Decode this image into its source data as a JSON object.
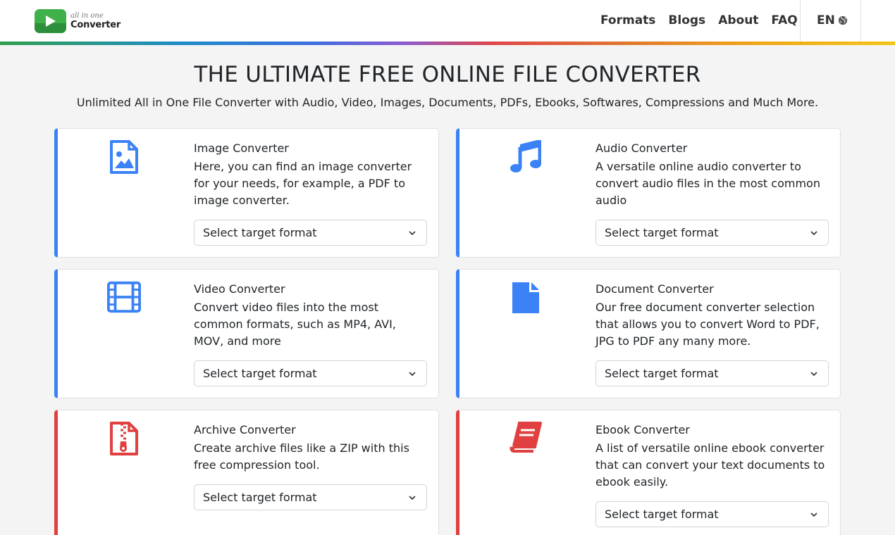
{
  "brand": {
    "tagline": "all in one",
    "name": "Converter"
  },
  "nav": {
    "items": [
      "Formats",
      "Blogs",
      "About",
      "FAQ"
    ],
    "language": "EN"
  },
  "hero": {
    "title": "THE ULTIMATE FREE ONLINE FILE CONVERTER",
    "subtitle": "Unlimited All in One File Converter with Audio, Video, Images, Documents, PDFs, Ebooks, Softwares, Compressions and Much More."
  },
  "colors": {
    "accent_blue": "#3b82f6",
    "accent_red": "#e04040",
    "brand_green": "#3fb04a"
  },
  "cards": [
    {
      "title": "Image Converter",
      "description": "Here, you can find an image converter for your needs, for example, a PDF to image converter.",
      "select_placeholder": "Select target format",
      "icon": "image-file-icon"
    },
    {
      "title": "Audio Converter",
      "description": "A versatile online audio converter to convert audio files in the most common audio",
      "select_placeholder": "Select target format",
      "icon": "music-icon"
    },
    {
      "title": "Video Converter",
      "description": "Convert video files into the most common formats, such as MP4, AVI, MOV, and more",
      "select_placeholder": "Select target format",
      "icon": "film-icon"
    },
    {
      "title": "Document Converter",
      "description": "Our free document converter selection that allows you to convert Word to PDF, JPG to PDF any many more.",
      "select_placeholder": "Select target format",
      "icon": "document-icon"
    },
    {
      "title": "Archive Converter",
      "description": "Create archive files like a ZIP with this free compression tool.",
      "select_placeholder": "Select target format",
      "icon": "zip-file-icon"
    },
    {
      "title": "Ebook Converter",
      "description": "A list of versatile online ebook converter that can convert your text documents to ebook easily.",
      "select_placeholder": "Select target format",
      "icon": "book-icon"
    }
  ]
}
